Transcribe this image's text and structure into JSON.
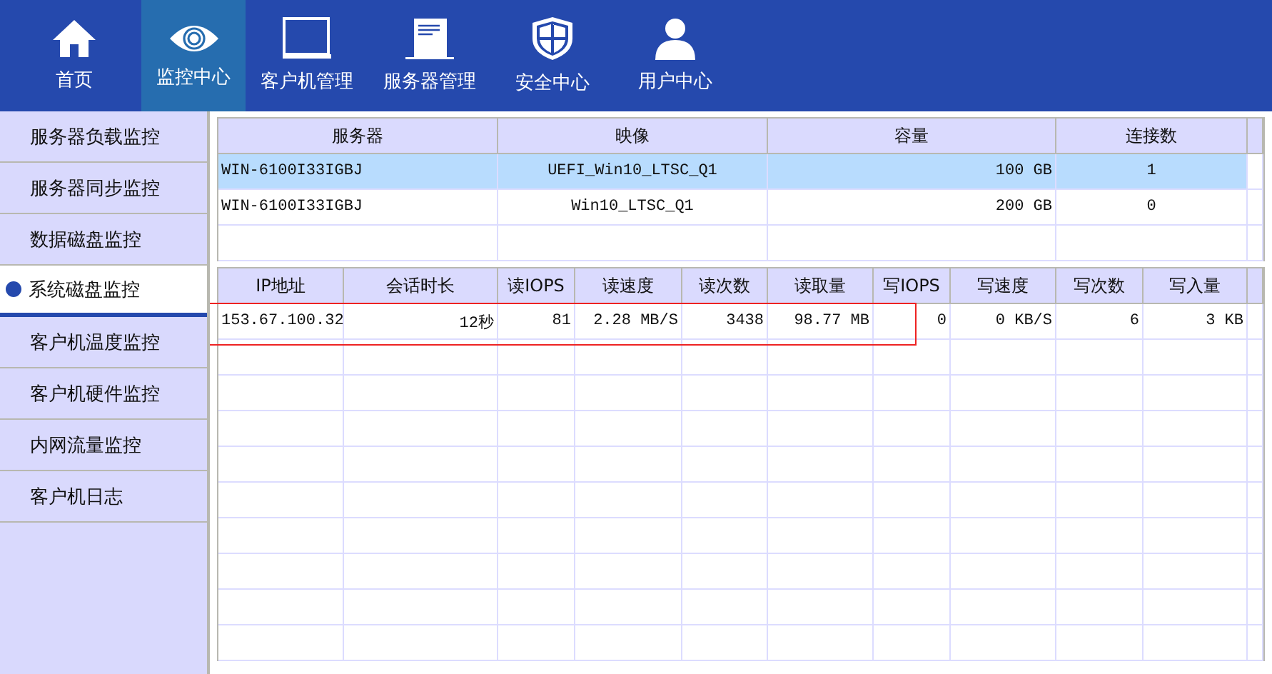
{
  "nav": [
    {
      "label": "首页",
      "selected": false
    },
    {
      "label": "监控中心",
      "selected": true
    },
    {
      "label": "客户机管理",
      "selected": false
    },
    {
      "label": "服务器管理",
      "selected": false
    },
    {
      "label": "安全中心",
      "selected": false
    },
    {
      "label": "用户中心",
      "selected": false
    }
  ],
  "sidebar": {
    "items": [
      {
        "label": "服务器负载监控",
        "selected": false
      },
      {
        "label": "服务器同步监控",
        "selected": false
      },
      {
        "label": "数据磁盘监控",
        "selected": false
      },
      {
        "label": "系统磁盘监控",
        "selected": true
      },
      {
        "label": "客户机温度监控",
        "selected": false
      },
      {
        "label": "客户机硬件监控",
        "selected": false
      },
      {
        "label": "内网流量监控",
        "selected": false
      },
      {
        "label": "客户机日志",
        "selected": false
      }
    ]
  },
  "server_table": {
    "columns": [
      "服务器",
      "映像",
      "容量",
      "连接数"
    ],
    "rows": [
      {
        "cells": [
          "WIN-6100I33IGBJ",
          "UEFI_Win10_LTSC_Q1",
          "100 GB",
          "1"
        ],
        "selected": true
      },
      {
        "cells": [
          "WIN-6100I33IGBJ",
          "Win10_LTSC_Q1",
          "200 GB",
          "0"
        ],
        "selected": false
      }
    ]
  },
  "session_table": {
    "columns": [
      "IP地址",
      "会话时长",
      "读IOPS",
      "读速度",
      "读次数",
      "读取量",
      "写IOPS",
      "写速度",
      "写次数",
      "写入量"
    ],
    "rows": [
      {
        "cells": [
          "153.67.100.32",
          "12秒",
          "81",
          "2.28 MB/S",
          "3438",
          "98.77 MB",
          "0",
          "0 KB/S",
          "6",
          "3 KB"
        ],
        "selected": false
      }
    ]
  }
}
